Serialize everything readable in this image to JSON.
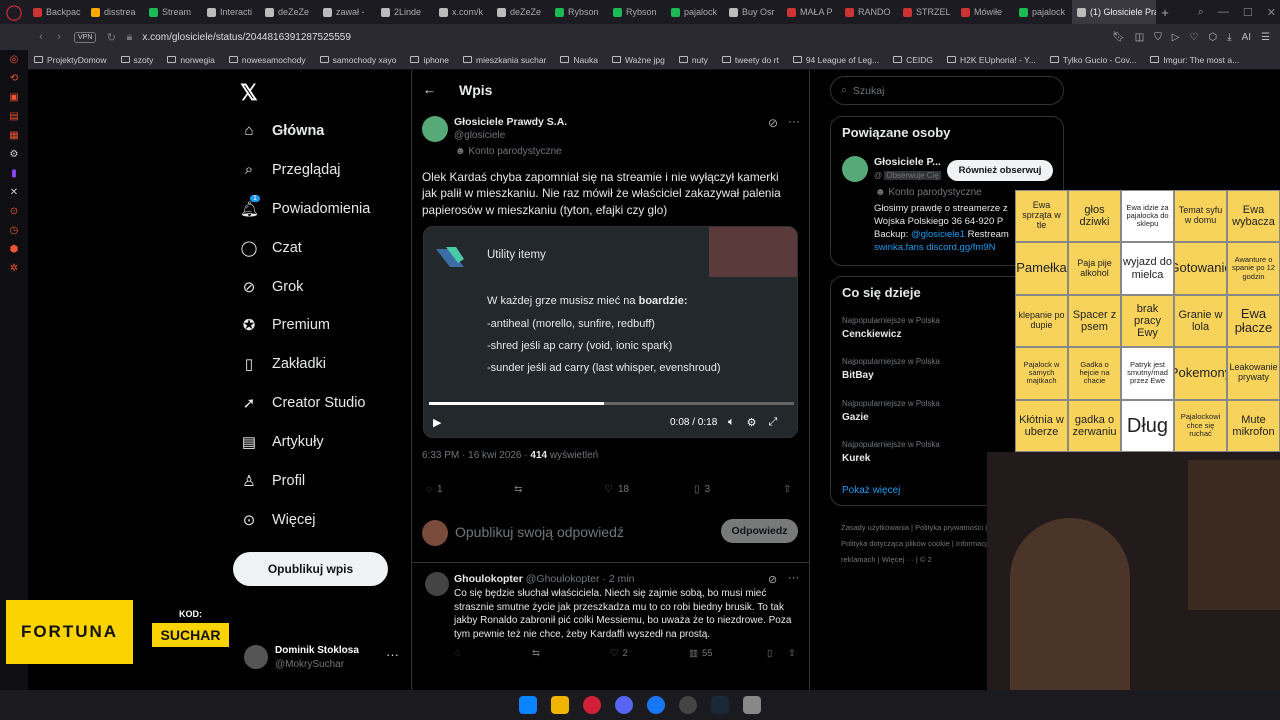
{
  "browser": {
    "tabs": [
      "Backpac",
      "disstrea",
      "Stream",
      "Interacti",
      "deZeZe",
      "zawał -",
      "2Linde",
      "x.com/k",
      "deZeZe",
      "Rybson",
      "Rybson",
      "pajalock",
      "Buy Osr",
      "MAŁA P",
      "RANDO",
      "STRZEL",
      "Mówiłe",
      "pajalock",
      "(1) Głosiciele Pra"
    ],
    "tab_colors": [
      "#c33",
      "#fa0",
      "#1db954",
      "#bbb",
      "#bbb",
      "#bbb",
      "#bbb",
      "#bbb",
      "#bbb",
      "#1db954",
      "#1db954",
      "#1db954",
      "#bbb",
      "#c33",
      "#c33",
      "#c33",
      "#c33",
      "#1db954",
      "#bbb"
    ],
    "url": "x.com/glosiciele/status/2044816391287525559",
    "vpn": "VPN",
    "bookmarks": [
      "ProjektyDomow",
      "szoty",
      "norwegia",
      "nowesamochody",
      "samochody xayo",
      "iphone",
      "mieszkania suchar",
      "Nauka",
      "Ważne jpg",
      "nuty",
      "tweety do rt",
      "94 League of Leg...",
      "CEIDG",
      "H2K EUphoria! - Y...",
      "Tylko Gucio - Cov...",
      "Imgur: The most a..."
    ]
  },
  "nav": {
    "items": [
      "Główna",
      "Przeglądaj",
      "Powiadomienia",
      "Czat",
      "Grok",
      "Premium",
      "Zakładki",
      "Creator Studio",
      "Artykuły",
      "Profil",
      "Więcej"
    ],
    "notif_count": "1",
    "post_button": "Opublikuj wpis",
    "user_name": "Dominik Stoklosa",
    "user_handle": "@MokrySuchar"
  },
  "ad": {
    "brand": "FORTUNA",
    "code_label": "KOD:",
    "code": "SUCHAR"
  },
  "header": {
    "title": "Wpis"
  },
  "post": {
    "author": "Głosiciele Prawdy S.A.",
    "handle": "@glosiciele",
    "badge": "Konto parodystyczne",
    "text": "Olek Kardaś chyba zapomniał się na streamie i nie wyłączył kamerki jak palił w mieszkaniu. Nie raz mówił że właściciel zakazywał palenia papierosów w mieszkaniu (tyton, efajki czy glo)",
    "video": {
      "title": "Utility itemy",
      "line0_pre": "W każdej grze musisz mieć na ",
      "line0_bold": "boardzie:",
      "line1": "-antiheal (morello,  sunfire, redbuff)",
      "line2": "-shred jeśli ap carry  (void, ionic spark)",
      "line3": "-sunder jeśli ad carry (last whisper, evenshroud)",
      "time": "0:08 / 0:18",
      "progress": 0.48
    },
    "timestamp": "6:33 PM · 16 kwi 2026 · ",
    "views": "414",
    "views_label": " wyświetleń",
    "replies": "1",
    "likes": "18",
    "bookmarks": "3"
  },
  "reply_box": {
    "placeholder": "Opublikuj swoją odpowiedź",
    "button": "Odpowiedz"
  },
  "comment": {
    "author": "Ghoulokopter",
    "handle": "@Ghoulokopter · 2 min",
    "text": "Co się będzie słuchał właściciela. Niech się zajmie sobą, bo musi mieć strasznie smutne życie jak przeszkadza mu to co robi biedny brusik. To tak jakby Ronaldo zabronił pić colki Messiemu, bo uważa że to niezdrowe. Poza tym pewnie też nie chce, żeby Kardaffi wyszedł na prostą.",
    "likes": "2",
    "views": "55"
  },
  "search": {
    "placeholder": "Szukaj"
  },
  "related": {
    "title": "Powiązane osoby",
    "name": "Głosiciele P...",
    "follows_you": "Obserwuje Cię",
    "follow_button": "Również obserwuj",
    "badge": "Konto parodystyczne",
    "bio": "Głosimy prawdę o streamerze z",
    "bio2": "Wojska Polskiego 36 64-920 P",
    "bio3_pre": "Backup: ",
    "bio3_link": "@glosiciele1",
    "bio3_post": " Restream",
    "bio4": "swinka.fans discord.gg/fm9N"
  },
  "trends": {
    "title": "Co się dzieje",
    "meta": "Najpopularniejsze w Polska",
    "items": [
      "Cenckiewicz",
      "BitBay",
      "Gazie",
      "Kurek"
    ],
    "show_more": "Pokaż więcej"
  },
  "footer": {
    "text": "Zasady użytkowania  |  Polityka prywatności  |  Polityka dotycząca plików cookie  |  Informacja o reklamach  |  Więcej ···  |  © 2"
  },
  "bingo": {
    "cells": [
      "Ewa sprząta w tle",
      "głos dziwki",
      "Ewa idzie za pajalocka do sklepu",
      "Temat syfu w domu",
      "Ewa wybacza",
      "\"Pamełka\"",
      "Paja pije alkohol",
      "wyjazd do mielca",
      "Gotowanie",
      "Awanture o spanie po 12 godzin",
      "klepanie po dupie",
      "Spacer z psem",
      "brak pracy Ewy",
      "Granie w lola",
      "Ewa płacze",
      "Pajalock w samych majtkach",
      "Gadka o hejcie na chacie",
      "Patryk jest smutny/mad przez Ewe",
      "Pokemony",
      "Leakowanie prywaty",
      "Kłótnia w uberze",
      "gadka o zerwaniu",
      "Dług",
      "Pajalockowi chce się ruchać",
      "Mute mikrofon"
    ]
  }
}
